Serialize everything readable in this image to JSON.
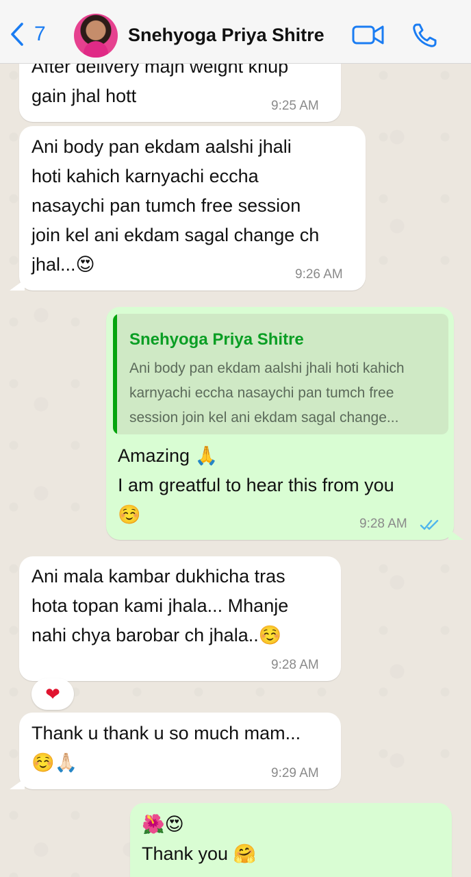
{
  "header": {
    "back_count": "7",
    "contact_name": "Snehyoga Priya Shitre"
  },
  "messages": [
    {
      "text": "After delivery majh weight khup\ngain jhal hott",
      "time": "9:25 AM"
    },
    {
      "text": "Ani body pan ekdam aalshi jhali\nhoti kahich karnyachi eccha\nnasaychi pan tumch free session\njoin kel ani ekdam sagal change ch\njhal...😍",
      "time": "9:26 AM"
    },
    {
      "quote_name": "Snehyoga Priya Shitre",
      "quote_text": "Ani body pan ekdam aalshi jhali hoti kahich karnyachi eccha nasaychi pan tumch free session join kel ani ekdam sagal change...",
      "text": "Amazing 🙏\nI am greatful to hear this from you\n☺️",
      "time": "9:28 AM"
    },
    {
      "text": "Ani mala kambar dukhicha tras\nhota topan kami jhala... Mhanje\nnahi chya barobar ch jhala..☺️",
      "time": "9:28 AM",
      "reaction": "❤"
    },
    {
      "text": "Thank u thank u so much mam...\n☺️🙏🏻",
      "time": "9:29 AM"
    },
    {
      "text": "🌺😍\nThank you 🤗"
    }
  ],
  "colors": {
    "accent": "#1a7cf2",
    "outgoing_bubble": "#d9fdd3",
    "quote_name": "#0a9e24",
    "read_ticks": "#4fb6ec"
  }
}
